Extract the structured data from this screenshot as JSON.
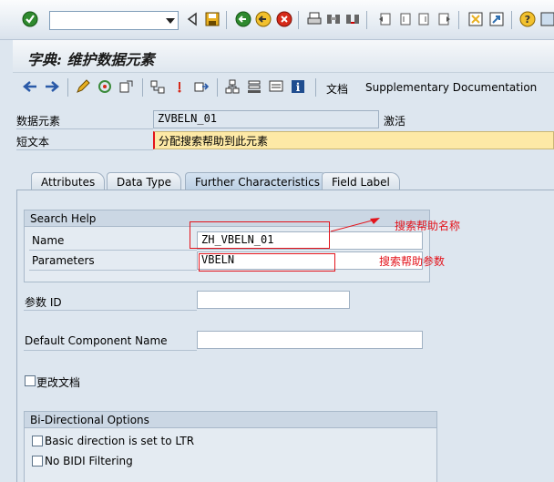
{
  "system_toolbar": {
    "command_field_value": "",
    "icons": [
      "enter-icon",
      "back-icon",
      "save-icon",
      "back-green-icon",
      "exit-icon",
      "cancel-icon",
      "print-icon",
      "find-icon",
      "find-next-icon",
      "first-page-icon",
      "prev-page-icon",
      "next-page-icon",
      "last-page-icon",
      "create-session-icon",
      "shortcut-icon",
      "help-icon",
      "layout-icon"
    ]
  },
  "title": "字典: 维护数据元素",
  "app_toolbar": {
    "doc_label": "文档",
    "supplementary_label": "Supplementary Documentation"
  },
  "header": {
    "data_element_label": "数据元素",
    "data_element_value": "ZVBELN_01",
    "status": "激活",
    "short_text_label": "短文本",
    "short_text_value": "分配搜索帮助到此元素"
  },
  "tabs": [
    {
      "label": "Attributes",
      "active": false
    },
    {
      "label": "Data Type",
      "active": false
    },
    {
      "label": "Further Characteristics",
      "active": true
    },
    {
      "label": "Field Label",
      "active": false
    }
  ],
  "search_help": {
    "group_title": "Search Help",
    "name_label": "Name",
    "name_value": "ZH_VBELN_01",
    "parameters_label": "Parameters",
    "parameters_value": "VBELN"
  },
  "annotations": {
    "name_note": "搜索帮助名称",
    "param_note": "搜索帮助参数"
  },
  "param_id": {
    "label": "参数 ID",
    "value": ""
  },
  "default_component": {
    "label": "Default Component Name",
    "value": ""
  },
  "change_doc": {
    "label": "更改文档",
    "checked": false
  },
  "bidi": {
    "group_title": "Bi-Directional Options",
    "ltr_label": "Basic direction is set to LTR",
    "ltr_checked": false,
    "no_filter_label": "No BIDI Filtering",
    "no_filter_checked": false
  },
  "colors": {
    "annotation": "#e3131b",
    "highlight": "#fde9a6"
  }
}
